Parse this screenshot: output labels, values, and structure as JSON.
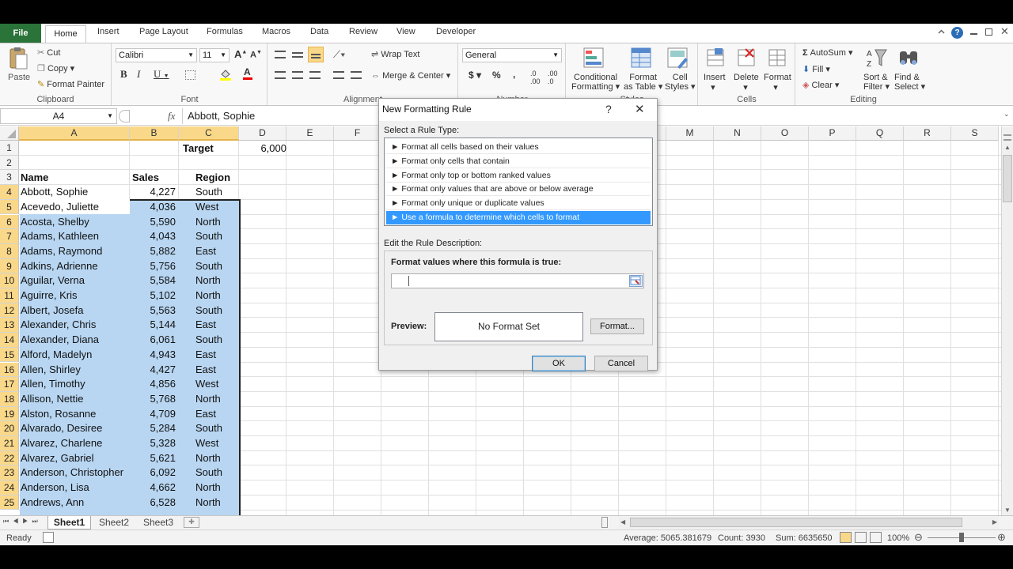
{
  "ribbon": {
    "tabs": [
      "File",
      "Home",
      "Insert",
      "Page Layout",
      "Formulas",
      "Macros",
      "Data",
      "Review",
      "View",
      "Developer"
    ],
    "clipboard": {
      "paste": "Paste",
      "cut": "Cut",
      "copy": "Copy",
      "format_painter": "Format Painter",
      "label": "Clipboard"
    },
    "font": {
      "name": "Calibri",
      "size": "11",
      "label": "Font"
    },
    "alignment": {
      "wrap": "Wrap Text",
      "merge": "Merge & Center",
      "label": "Alignment"
    },
    "number": {
      "format": "General",
      "label": "Number"
    },
    "styles": {
      "conditional": "Conditional",
      "conditional2": "Formatting",
      "format_as": "Format",
      "format_as2": "as Table",
      "cell": "Cell",
      "cell2": "Styles",
      "label": "Styles"
    },
    "cells": {
      "insert": "Insert",
      "delete": "Delete",
      "format": "Format",
      "label": "Cells"
    },
    "editing": {
      "autosum": "AutoSum",
      "fill": "Fill",
      "clear": "Clear",
      "sort": "Sort &",
      "sort2": "Filter",
      "find": "Find &",
      "find2": "Select",
      "label": "Editing"
    }
  },
  "formula_bar": {
    "name_box": "A4",
    "fx": "fx",
    "content": "Abbott, Sophie"
  },
  "columns": [
    "A",
    "B",
    "C",
    "D",
    "E",
    "F",
    "G",
    "H",
    "I",
    "J",
    "K",
    "L",
    "M",
    "N",
    "O",
    "P",
    "Q",
    "R",
    "S"
  ],
  "rows": [
    "1",
    "2",
    "3",
    "4",
    "5",
    "6",
    "7",
    "8",
    "9",
    "10",
    "11",
    "12",
    "13",
    "14",
    "15",
    "16",
    "17",
    "18",
    "19",
    "20",
    "21",
    "22",
    "23",
    "24",
    "25"
  ],
  "cells_top": {
    "target_label": "Target",
    "target_value": "6,000",
    "h_name": "Name",
    "h_sales": "Sales",
    "h_region": "Region"
  },
  "data_rows": [
    [
      "Abbott, Sophie",
      "4,227",
      "South"
    ],
    [
      "Acevedo, Juliette",
      "4,036",
      "West"
    ],
    [
      "Acosta, Shelby",
      "5,590",
      "North"
    ],
    [
      "Adams, Kathleen",
      "4,043",
      "South"
    ],
    [
      "Adams, Raymond",
      "5,882",
      "East"
    ],
    [
      "Adkins, Adrienne",
      "5,756",
      "South"
    ],
    [
      "Aguilar, Verna",
      "5,584",
      "North"
    ],
    [
      "Aguirre, Kris",
      "5,102",
      "North"
    ],
    [
      "Albert, Josefa",
      "5,563",
      "South"
    ],
    [
      "Alexander, Chris",
      "5,144",
      "East"
    ],
    [
      "Alexander, Diana",
      "6,061",
      "South"
    ],
    [
      "Alford, Madelyn",
      "4,943",
      "East"
    ],
    [
      "Allen, Shirley",
      "4,427",
      "East"
    ],
    [
      "Allen, Timothy",
      "4,856",
      "West"
    ],
    [
      "Allison, Nettie",
      "5,768",
      "North"
    ],
    [
      "Alston, Rosanne",
      "4,709",
      "East"
    ],
    [
      "Alvarado, Desiree",
      "5,284",
      "South"
    ],
    [
      "Alvarez, Charlene",
      "5,328",
      "West"
    ],
    [
      "Alvarez, Gabriel",
      "5,621",
      "North"
    ],
    [
      "Anderson, Christopher",
      "6,092",
      "South"
    ],
    [
      "Anderson, Lisa",
      "4,662",
      "North"
    ],
    [
      "Andrews, Ann",
      "6,528",
      "North"
    ]
  ],
  "dialog": {
    "title": "New Formatting Rule",
    "help": "?",
    "select_label": "Select a Rule Type:",
    "rule_types": [
      "Format all cells based on their values",
      "Format only cells that contain",
      "Format only top or bottom ranked values",
      "Format only values that are above or below average",
      "Format only unique or duplicate values",
      "Use a formula to determine which cells to format"
    ],
    "selected_index": 5,
    "edit_label": "Edit the Rule Description:",
    "formula_label": "Format values where this formula is true:",
    "formula_value": "",
    "preview_label": "Preview:",
    "preview_text": "No Format Set",
    "format_button": "Format...",
    "ok": "OK",
    "cancel": "Cancel"
  },
  "sheets": [
    "Sheet1",
    "Sheet2",
    "Sheet3"
  ],
  "status": {
    "ready": "Ready",
    "average": "Average: 5065.381679",
    "count": "Count: 3930",
    "sum": "Sum: 6635650",
    "zoom": "100%"
  },
  "colors": {
    "file_tab": "#2a7339",
    "selection": "#b8d6f2",
    "dialog_select": "#3399ff",
    "header_sel": "#f9d88a"
  }
}
